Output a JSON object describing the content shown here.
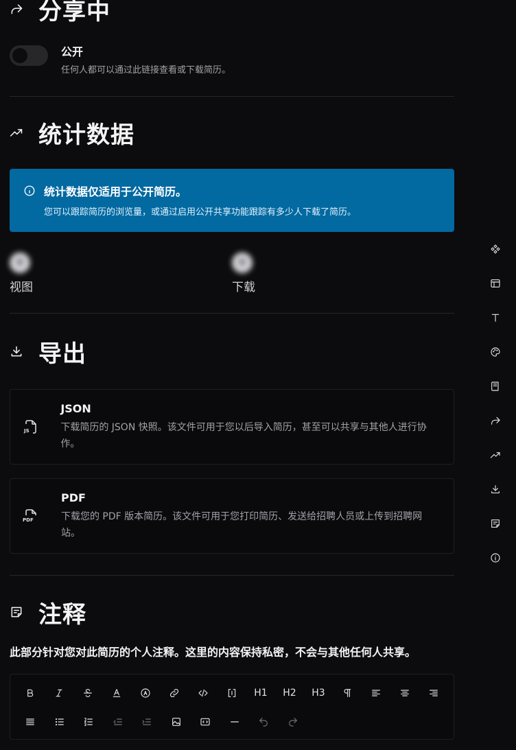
{
  "sharing": {
    "title": "分享中",
    "public_label": "公开",
    "public_desc": "任何人都可以通过此链接查看或下载简历。",
    "toggle_on": false
  },
  "statistics": {
    "title": "统计数据",
    "alert_title": "统计数据仅适用于公开简历。",
    "alert_desc": "您可以跟踪简历的浏览量，或通过启用公开共享功能跟踪有多少人下载了简历。",
    "views_value": "0",
    "views_label": "视图",
    "downloads_value": "0",
    "downloads_label": "下载"
  },
  "export": {
    "title": "导出",
    "json_title": "JSON",
    "json_desc": "下载简历的 JSON 快照。该文件可用于您以后导入简历，甚至可以共享与其他人进行协作。",
    "json_icon_text": "JS",
    "pdf_title": "PDF",
    "pdf_desc": "下载您的 PDF 版本简历。该文件可用于您打印简历、发送给招聘人员或上传到招聘网站。",
    "pdf_icon_text": "PDF"
  },
  "notes": {
    "title": "注释",
    "desc": "此部分针对您对此简历的个人注释。这里的内容保持私密，不会与其他任何人共享。",
    "h1": "H1",
    "h2": "H2",
    "h3": "H3"
  },
  "icons": {
    "sharing": "share-arrow-icon",
    "statistics": "trending-up-icon",
    "export": "download-icon",
    "notes": "note-icon",
    "rail": [
      "diamonds-icon",
      "layout-icon",
      "type-icon",
      "palette-icon",
      "book-icon",
      "share-arrow-icon",
      "trending-up-icon",
      "download-icon",
      "note-icon",
      "info-icon"
    ]
  },
  "colors": {
    "background": "#0c0c0e",
    "alert": "#0369a1",
    "card": "#0a0a0c"
  }
}
